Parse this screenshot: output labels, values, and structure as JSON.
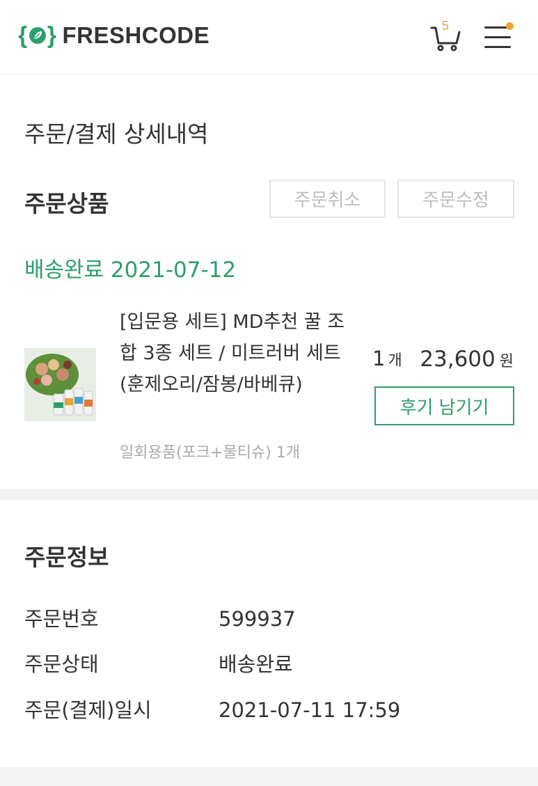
{
  "header": {
    "brand": "FRESHCODE",
    "cart_count": "5"
  },
  "order": {
    "page_title": "주문/결제 상세내역",
    "section_title": "주문상품",
    "cancel_label": "주문취소",
    "edit_label": "주문수정",
    "delivery_status": "배송완료 2021-07-12",
    "product": {
      "name": "[입문용 세트] MD추천 꿀 조합 3종 세트 / 미트러버 세트 (훈제오리/잠봉/바베큐)",
      "option": "일회용품(포크+물티슈) 1개",
      "quantity": "1",
      "quantity_unit": "개",
      "price": "23,600",
      "price_unit": "원",
      "review_label": "후기 남기기"
    }
  },
  "info": {
    "title": "주문정보",
    "rows": [
      {
        "label": "주문번호",
        "value": "599937"
      },
      {
        "label": "주문상태",
        "value": "배송완료"
      },
      {
        "label": "주문(결제)일시",
        "value": "2021-07-11 17:59"
      }
    ]
  },
  "colors": {
    "accent_green": "#2e9e6b",
    "badge_orange": "#f0a432"
  }
}
